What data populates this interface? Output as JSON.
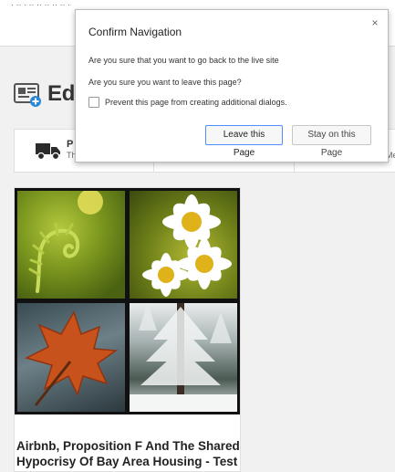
{
  "topbar": {
    "cut_text": "· ·· · ·· ·· ·· ·· ·· ·"
  },
  "page": {
    "heading": "Edit"
  },
  "tabs": {
    "first_title_cut": "P",
    "first_sub_cut": "Th",
    "right_cut": "Me"
  },
  "card": {
    "title": "Airbnb, Proposition F And The Shared Hypocrisy Of Bay Area Housing - Test"
  },
  "dialog": {
    "title": "Confirm Navigation",
    "close_glyph": "×",
    "message1": "Are you sure that you want to go back to the live site",
    "message2": "Are you sure you want to leave this page?",
    "checkbox_label": "Prevent this page from creating additional dialogs.",
    "leave_button": "Leave this Page",
    "stay_button": "Stay on this Page"
  },
  "colors": {
    "accent_blue": "#4d90fe",
    "icon_blue": "#2b87d8",
    "truck": "#2b2b2b"
  },
  "icons": [
    "edit-article-icon",
    "truck-icon",
    "close-icon"
  ]
}
